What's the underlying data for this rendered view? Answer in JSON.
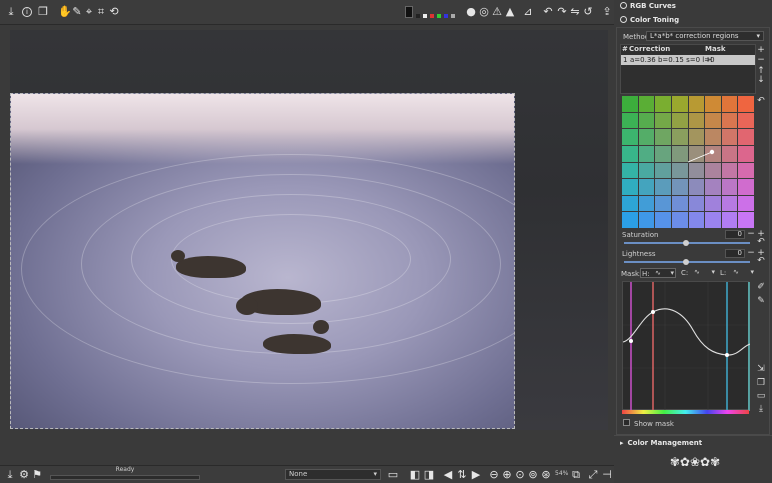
{
  "toolbar": {
    "left_icons": [
      "save-icon",
      "info-icon",
      "copy-icon",
      "hand-icon",
      "colorpicker-icon",
      "picker-icon",
      "crop-icon",
      "straighten-icon"
    ],
    "right_icons": [
      "preview-mode-icon",
      "focus-mask-icon",
      "clipping-warn-icon",
      "warning-icon",
      "histogram-icon",
      "rotate-left-icon",
      "rotate-right-icon",
      "flip-h-icon",
      "flip-v-icon",
      "undo-icon",
      "export-icon"
    ]
  },
  "status": {
    "progress_label": "Ready",
    "profile_select": "None",
    "zoom": "54%"
  },
  "panel": {
    "rgb_curves_title": "RGB Curves",
    "color_toning_title": "Color Toning",
    "method_label": "Method",
    "method_value": "L*a*b* correction regions",
    "list_col_num": "#",
    "list_col_correction": "Correction",
    "list_col_mask": "Mask",
    "list_row_num": "1",
    "list_row_correction": "a=0.36 b=0.15 s=0 l=0",
    "list_row_mask": "H",
    "saturation_label": "Saturation",
    "saturation_value": "0",
    "lightness_label": "Lightness",
    "lightness_value": "0",
    "mask_label": "Mask:",
    "mask_h": "H:",
    "mask_c": "C:",
    "mask_l": "L:",
    "show_mask_label": "Show mask",
    "color_management_title": "Color Management"
  },
  "colors": {
    "grid": [
      [
        "#3cae3c",
        "#5aae35",
        "#7aae30",
        "#9aa82e",
        "#b89a33",
        "#cf8a35",
        "#e0753a",
        "#ef6540"
      ],
      [
        "#3cb255",
        "#56ac4e",
        "#74a848",
        "#92a244",
        "#ad9646",
        "#c5874a",
        "#d97650",
        "#e96658"
      ],
      [
        "#3cb56e",
        "#54ad68",
        "#6fa662",
        "#8a9f5e",
        "#a3955e",
        "#bb8762",
        "#d17668",
        "#e16670"
      ],
      [
        "#38b68a",
        "#50ad84",
        "#68a47e",
        "#80997c",
        "#9a8f7c",
        "#b3847f",
        "#c97586",
        "#dc668d"
      ],
      [
        "#34b3a6",
        "#4aa9a1",
        "#61a09d",
        "#79979a",
        "#928e9b",
        "#ab839d",
        "#c277a5",
        "#d66bae"
      ],
      [
        "#30adc0",
        "#44a4be",
        "#5b9cbb",
        "#7394ba",
        "#8c8bbb",
        "#a482bf",
        "#bb77c6",
        "#d06cce"
      ],
      [
        "#2da5d6",
        "#419dd7",
        "#5996d6",
        "#708fd7",
        "#8888d9",
        "#a081dc",
        "#b77ae2",
        "#cc70e8"
      ],
      [
        "#2b9fe6",
        "#3f98e8",
        "#5692e9",
        "#6c8de9",
        "#8388ec",
        "#9b83ef",
        "#b17df2",
        "#c876f5"
      ]
    ]
  }
}
